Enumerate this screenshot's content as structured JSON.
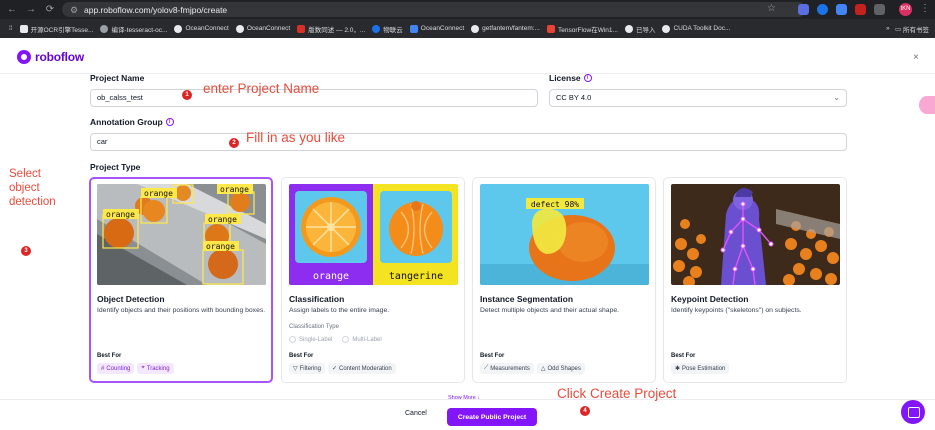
{
  "browser": {
    "url": "app.roboflow.com/yolov8-fmjpo/create",
    "bookmarks": [
      "开源OCR引擎Tesse...",
      "编译-tesseract-oc...",
      "OceanConnect",
      "OceanConnect",
      "版数同述 — 2.0，...",
      "物联云",
      "OceanConnect",
      "getfantem/fantem:...",
      "TensorFlow在Win1...",
      "已导入",
      "CUDA Toolkit Doc..."
    ],
    "bookmarks_more": "所有书签",
    "avatar_text": "tKN"
  },
  "app": {
    "logo": "roboflow",
    "close": "×"
  },
  "form": {
    "project_name_label": "Project Name",
    "project_name_value": "ob_calss_test",
    "license_label": "License",
    "license_value": "CC BY 4.0",
    "annotation_group_label": "Annotation Group",
    "annotation_group_value": "car",
    "project_type_label": "Project Type"
  },
  "cards": [
    {
      "title": "Object Detection",
      "desc": "Identify objects and their positions with bounding boxes.",
      "bestfor": "Best For",
      "tags": [
        "Counting",
        "Tracking"
      ],
      "image_labels": [
        "orange",
        "orange",
        "orange",
        "orange",
        "orange",
        "orange"
      ]
    },
    {
      "title": "Classification",
      "desc": "Assign labels to the entire image.",
      "type_label": "Classification Type",
      "radio1": "Single-Label",
      "radio2": "Multi-Label",
      "bestfor": "Best For",
      "tags": [
        "Filtering",
        "Content Moderation"
      ],
      "image_labels": [
        "orange",
        "tangerine"
      ]
    },
    {
      "title": "Instance Segmentation",
      "desc": "Detect multiple objects and their actual shape.",
      "bestfor": "Best For",
      "tags": [
        "Measurements",
        "Odd Shapes"
      ],
      "image_labels": [
        "defect 98%"
      ]
    },
    {
      "title": "Keypoint Detection",
      "desc": "Identify keypoints (\"skeletons\") on subjects.",
      "bestfor": "Best For",
      "tags": [
        "Pose Estimation"
      ]
    }
  ],
  "footer": {
    "show_more": "Show More ↓",
    "cancel": "Cancel",
    "create": "Create Public Project"
  },
  "annotations": {
    "a1": "enter Project Name",
    "a2": "Fill in as you like",
    "a3": "Select\nobject\ndetection",
    "a4": "Click Create Project",
    "d1": "1",
    "d2": "2",
    "d3": "3",
    "d4": "4"
  }
}
